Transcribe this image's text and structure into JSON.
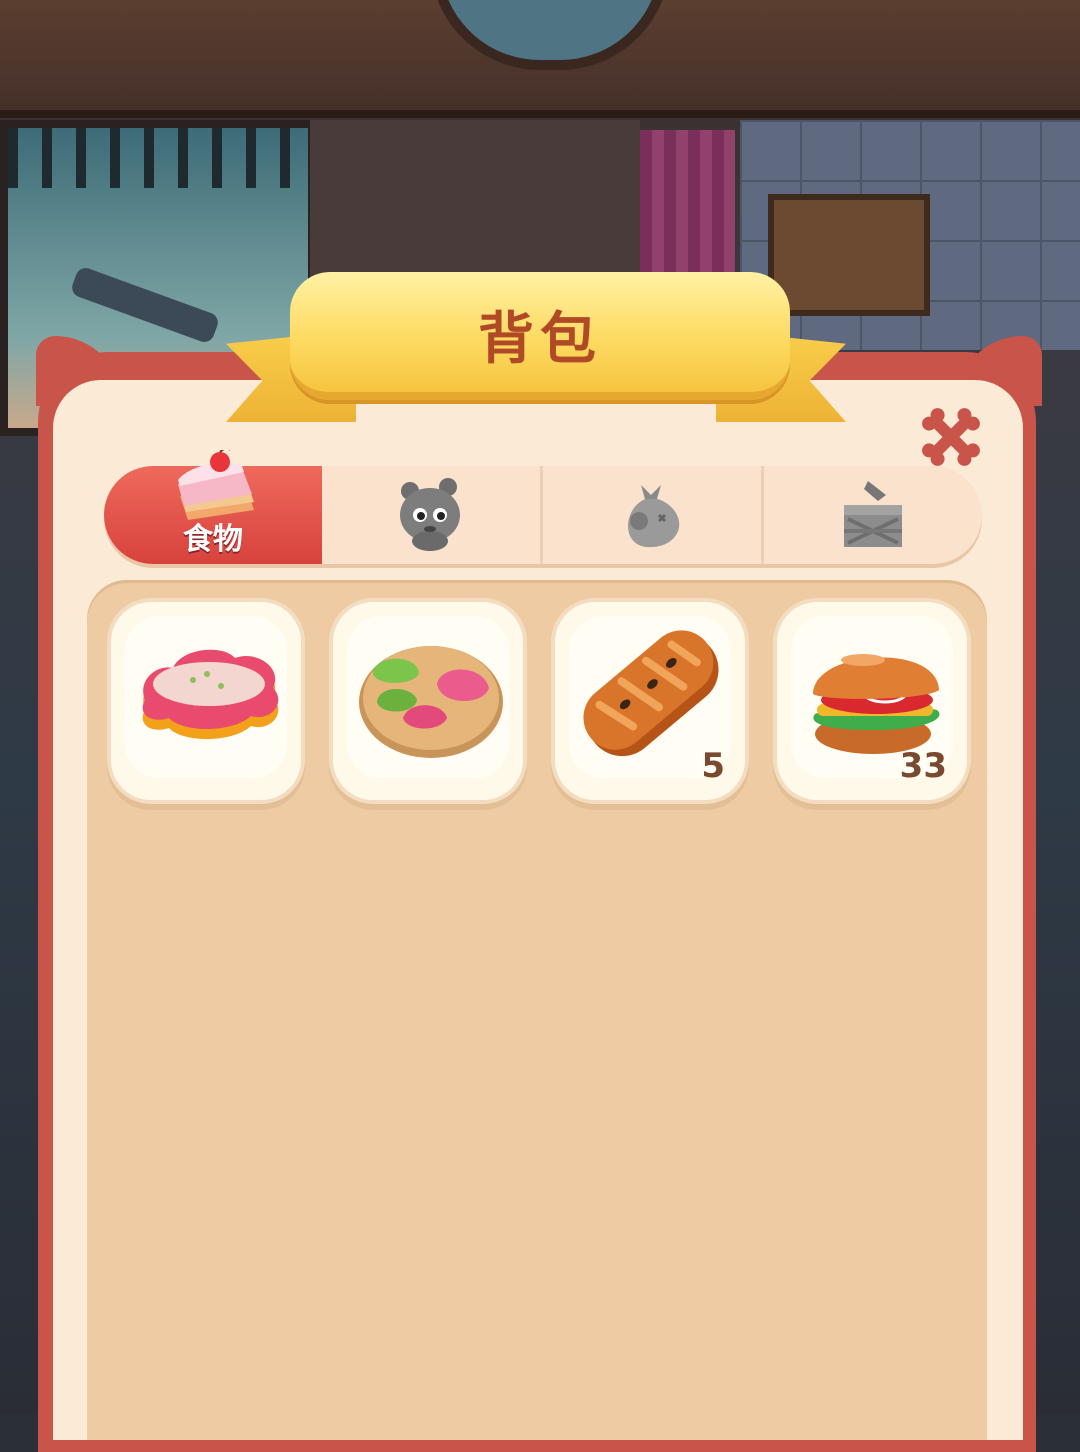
{
  "window": {
    "title": "背包"
  },
  "tabs": [
    {
      "label": "食物",
      "icon": "cake-slice-icon",
      "active": true
    },
    {
      "label": "",
      "icon": "plush-bear-icon",
      "active": false
    },
    {
      "label": "",
      "icon": "sack-icon",
      "active": false
    },
    {
      "label": "",
      "icon": "crate-icon",
      "active": false
    }
  ],
  "items": [
    {
      "icon": "rice-cake-icon",
      "count": ""
    },
    {
      "icon": "dumplings-plate-icon",
      "count": ""
    },
    {
      "icon": "bread-loaf-icon",
      "count": "5"
    },
    {
      "icon": "hamburger-icon",
      "count": "33"
    }
  ],
  "close_icon": "close-bone-icon",
  "colors": {
    "frame": "#c8544a",
    "panel": "#fbead6",
    "inner": "#eecba2",
    "ribbon": "#fddb63",
    "title_text": "#b04a26",
    "active_tab": "#e2544b"
  }
}
